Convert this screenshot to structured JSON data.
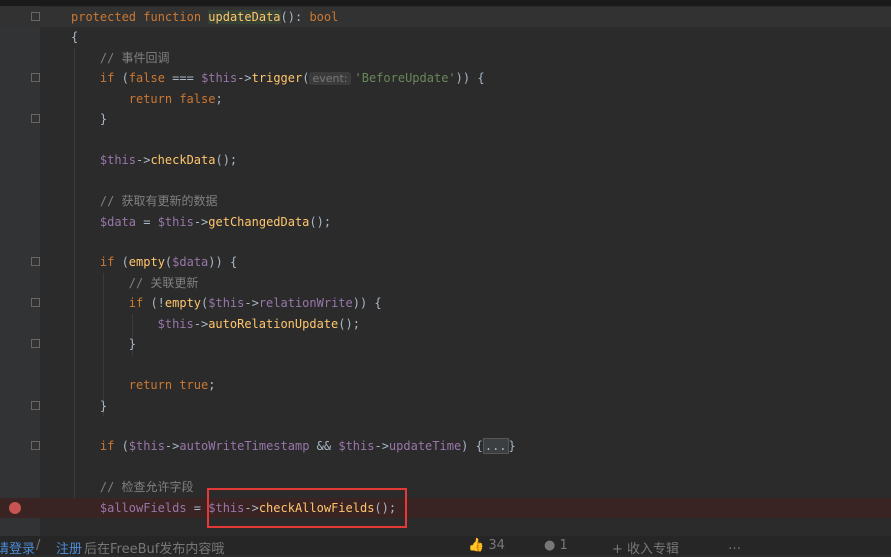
{
  "editor": {
    "colors": {
      "keyword": "#cc7832",
      "function": "#ffc66d",
      "variable": "#9876aa",
      "comment": "#808080",
      "string": "#6a8759",
      "text": "#a9b7c6",
      "breakpoint": "#c75450",
      "highlight_box": "#e53935"
    },
    "lines": [
      {
        "indent": 0,
        "fold": true,
        "current": true,
        "tokens": [
          [
            "k",
            "protected function "
          ],
          [
            "f hl",
            "updateData"
          ],
          [
            "t",
            "(): "
          ],
          [
            "k",
            "bool"
          ]
        ]
      },
      {
        "indent": 0,
        "tokens": [
          [
            "t",
            "{"
          ]
        ]
      },
      {
        "indent": 1,
        "tokens": [
          [
            "c",
            "// 事件回调"
          ]
        ]
      },
      {
        "indent": 1,
        "fold": true,
        "tokens": [
          [
            "k",
            "if "
          ],
          [
            "t",
            "("
          ],
          [
            "k",
            "false "
          ],
          [
            "t",
            "=== "
          ],
          [
            "v",
            "$this"
          ],
          [
            "t",
            "->"
          ],
          [
            "f",
            "trigger"
          ],
          [
            "t",
            "("
          ],
          [
            "h",
            "event:"
          ],
          [
            "s",
            "'BeforeUpdate'"
          ],
          [
            "t",
            ")) {"
          ]
        ]
      },
      {
        "indent": 2,
        "tokens": [
          [
            "k",
            "return false"
          ],
          [
            "t",
            ";"
          ]
        ]
      },
      {
        "indent": 1,
        "fold": true,
        "tokens": [
          [
            "t",
            "}"
          ]
        ]
      },
      {
        "indent": 1,
        "tokens": []
      },
      {
        "indent": 1,
        "tokens": [
          [
            "v",
            "$this"
          ],
          [
            "t",
            "->"
          ],
          [
            "f",
            "checkData"
          ],
          [
            "t",
            "();"
          ]
        ]
      },
      {
        "indent": 1,
        "tokens": []
      },
      {
        "indent": 1,
        "tokens": [
          [
            "c",
            "// 获取有更新的数据"
          ]
        ]
      },
      {
        "indent": 1,
        "tokens": [
          [
            "v",
            "$data "
          ],
          [
            "t",
            "= "
          ],
          [
            "v",
            "$this"
          ],
          [
            "t",
            "->"
          ],
          [
            "f",
            "getChangedData"
          ],
          [
            "t",
            "();"
          ]
        ]
      },
      {
        "indent": 1,
        "tokens": []
      },
      {
        "indent": 1,
        "fold": true,
        "tokens": [
          [
            "k",
            "if "
          ],
          [
            "t",
            "("
          ],
          [
            "f",
            "empty"
          ],
          [
            "t",
            "("
          ],
          [
            "v",
            "$data"
          ],
          [
            "t",
            ")) {"
          ]
        ]
      },
      {
        "indent": 2,
        "tokens": [
          [
            "c",
            "// 关联更新"
          ]
        ]
      },
      {
        "indent": 2,
        "fold": true,
        "tokens": [
          [
            "k",
            "if "
          ],
          [
            "t",
            "(!"
          ],
          [
            "f",
            "empty"
          ],
          [
            "t",
            "("
          ],
          [
            "v",
            "$this"
          ],
          [
            "t",
            "->"
          ],
          [
            "p",
            "relationWrite"
          ],
          [
            "t",
            ")) {"
          ]
        ]
      },
      {
        "indent": 3,
        "tokens": [
          [
            "v",
            "$this"
          ],
          [
            "t",
            "->"
          ],
          [
            "f",
            "autoRelationUpdate"
          ],
          [
            "t",
            "();"
          ]
        ]
      },
      {
        "indent": 2,
        "fold": true,
        "tokens": [
          [
            "t",
            "}"
          ]
        ]
      },
      {
        "indent": 2,
        "tokens": []
      },
      {
        "indent": 2,
        "tokens": [
          [
            "k",
            "return true"
          ],
          [
            "t",
            ";"
          ]
        ]
      },
      {
        "indent": 1,
        "fold": true,
        "tokens": [
          [
            "t",
            "}"
          ]
        ]
      },
      {
        "indent": 1,
        "tokens": []
      },
      {
        "indent": 1,
        "fold": true,
        "tokens": [
          [
            "k",
            "if "
          ],
          [
            "t",
            "("
          ],
          [
            "v",
            "$this"
          ],
          [
            "t",
            "->"
          ],
          [
            "p",
            "autoWriteTimestamp "
          ],
          [
            "t",
            "&& "
          ],
          [
            "v",
            "$this"
          ],
          [
            "t",
            "->"
          ],
          [
            "p",
            "updateTime"
          ],
          [
            "t",
            ") {"
          ],
          [
            "fold-box",
            "..."
          ],
          [
            "t",
            "}"
          ]
        ]
      },
      {
        "indent": 1,
        "tokens": []
      },
      {
        "indent": 1,
        "tokens": [
          [
            "c",
            "// 检查允许字段"
          ]
        ]
      },
      {
        "indent": 1,
        "breakpoint": true,
        "tokens": [
          [
            "v",
            "$allowFields "
          ],
          [
            "t",
            "= "
          ],
          [
            "v",
            "$this"
          ],
          [
            "t",
            "->"
          ],
          [
            "f",
            "checkAllowFields"
          ],
          [
            "t",
            "();"
          ]
        ]
      }
    ]
  },
  "footer": {
    "login": "请登录",
    "sep": " / ",
    "register": "注册",
    "prompt": "后在FreeBuf发布内容哦",
    "likes": "👍 34",
    "comments": "● 1",
    "collect": "+ 收入专辑",
    "more": "…"
  }
}
